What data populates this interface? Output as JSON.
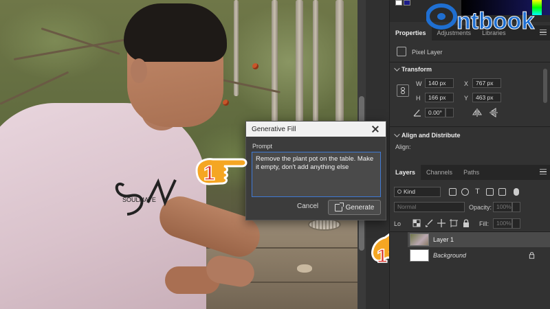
{
  "dialog": {
    "title": "Generative Fill",
    "prompt_label": "Prompt",
    "prompt_text": "Remove the plant pot on the table. Make it empty, don't add anything else",
    "cancel_label": "Cancel",
    "generate_label": "Generate"
  },
  "annotations": {
    "step_1": "1",
    "step_2": "1"
  },
  "watermark": {
    "text": "ntbook"
  },
  "shirt_print": {
    "text": "SOULMATE"
  },
  "panel_tabs": [
    {
      "label": "Properties",
      "active": true
    },
    {
      "label": "Adjustments",
      "active": false
    },
    {
      "label": "Libraries",
      "active": false
    }
  ],
  "properties": {
    "layer_type": "Pixel Layer",
    "transform_title": "Transform",
    "w_label": "W",
    "w_value": "140 px",
    "x_label": "X",
    "x_value": "767 px",
    "h_label": "H",
    "h_value": "166 px",
    "y_label": "Y",
    "y_value": "463 px",
    "angle_value": "0.00°",
    "align_title": "Align and Distribute",
    "align_label": "Align:"
  },
  "layer_tabs": [
    {
      "label": "Layers",
      "active": true
    },
    {
      "label": "Channels",
      "active": false
    },
    {
      "label": "Paths",
      "active": false
    }
  ],
  "layers": {
    "filter_kind": "Kind",
    "blend_mode": "Normal",
    "opacity_label": "Opacity:",
    "opacity_value": "100%",
    "lock_label": "Lock:",
    "lock_label_visible": "Lo",
    "fill_label": "Fill:",
    "fill_value": "100%",
    "items": [
      {
        "name": "Layer 1",
        "selected": true
      },
      {
        "name": "Background",
        "selected": false
      }
    ]
  },
  "colors": {
    "accent": "#3f7ad6",
    "panel_bg": "#323232",
    "watermark_blue": "#1f6fd1",
    "pointer_orange": "#f5a623"
  }
}
